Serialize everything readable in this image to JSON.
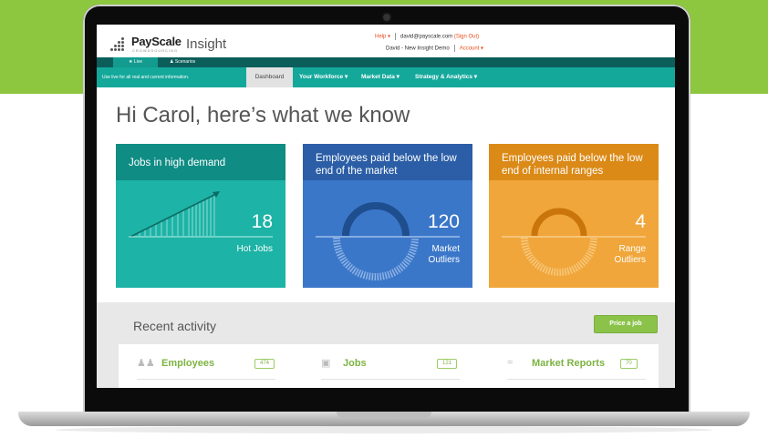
{
  "header": {
    "logo": "PayScale",
    "logo_sub": "CROWDSOURCING",
    "product": "Insight",
    "help": "Help ▾",
    "email": "david@payscale.com",
    "sign_out": "(Sign Out)",
    "account_name": "David - New Insight Demo",
    "account_menu": "Account ▾"
  },
  "mode_tabs": {
    "live": "★ Live",
    "scenarios": "♟ Scenarios"
  },
  "nav": {
    "info": "Use live for all real and current information.",
    "dashboard": "Dashboard",
    "workforce": "Your Workforce ▾",
    "market": "Market Data ▾",
    "strategy": "Strategy & Analytics ▾"
  },
  "greeting": "Hi Carol, here’s what we know",
  "cards": [
    {
      "title": "Jobs in high demand",
      "value": "18",
      "label1": "Hot Jobs",
      "label2": "",
      "head_color": "#0f8c84",
      "body_color": "#1db3a6"
    },
    {
      "title": "Employees paid below the low end of the market",
      "value": "120",
      "label1": "Market",
      "label2": "Outliers",
      "head_color": "#2b5ea6",
      "body_color": "#3b77c9"
    },
    {
      "title": "Employees paid below the low end of internal ranges",
      "value": "4",
      "label1": "Range",
      "label2": "Outliers",
      "head_color": "#db8a17",
      "body_color": "#f0a63a"
    }
  ],
  "recent": {
    "title": "Recent activity",
    "price_button": "Price a job",
    "columns": [
      {
        "label": "Employees",
        "count": "474",
        "icon": "people-icon"
      },
      {
        "label": "Jobs",
        "count": "121",
        "icon": "briefcase-icon"
      },
      {
        "label": "Market Reports",
        "count": "70",
        "icon": "trend-icon"
      }
    ]
  }
}
